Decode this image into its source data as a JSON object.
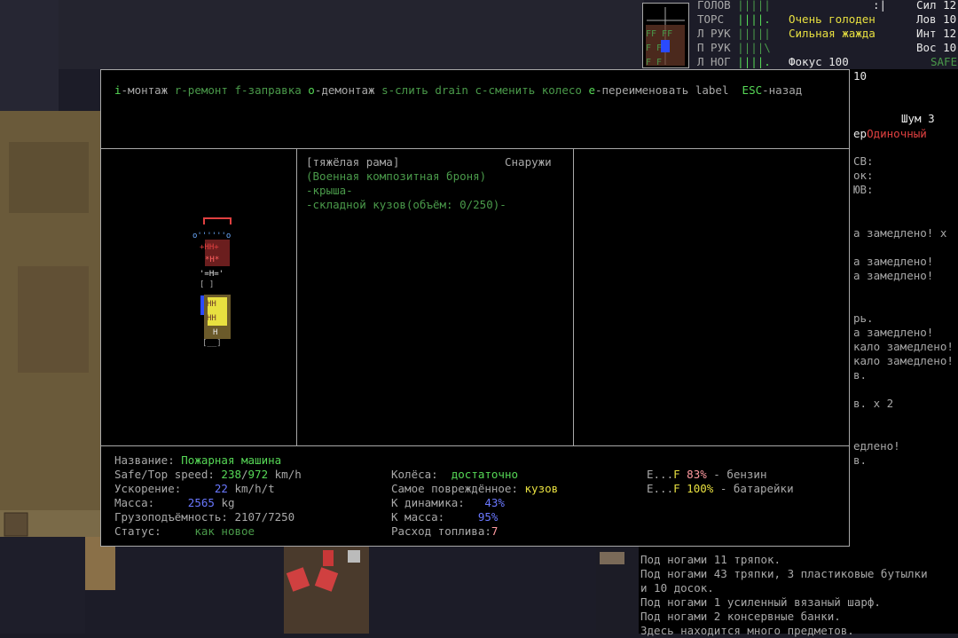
{
  "keys": [
    {
      "k": "i",
      "label": "-монтаж"
    },
    {
      "k": "r",
      "label": "-ремонт"
    },
    {
      "k": "f",
      "label": "-заправка"
    },
    {
      "k": "o",
      "label": "-демонтаж"
    },
    {
      "k": "s",
      "label": "-слить"
    },
    {
      "k": "d",
      "label": "rain"
    },
    {
      "k": "c",
      "label": "-сменить колесо"
    },
    {
      "k": "e",
      "label": "-переименовать label"
    },
    {
      "k": "ESC",
      "label": "-назад"
    }
  ],
  "parts": {
    "frame": "[тяжёлая рама]",
    "location": "Снаружи",
    "armor": "(Военная композитная броня)",
    "roof": "-крыша-",
    "box": "-складной кузов(объём: 0/250)-"
  },
  "stats": {
    "name_label": "Название:",
    "name": "Пожарная машина",
    "speed_label": "Safe/Top speed:",
    "speed_safe": "238",
    "speed_top": "972",
    "speed_unit": "km/h",
    "accel_label": "Ускорение:",
    "accel": "22",
    "accel_unit": "km/h/t",
    "mass_label": "Масса:",
    "mass": "2565",
    "mass_unit": "kg",
    "cargo_label": "Грузоподъёмность:",
    "cargo": "2107/7250",
    "status_label": "Статус:",
    "status": "как новое",
    "wheels_label": "Колёса:",
    "wheels": "достаточно",
    "damaged_label": "Самое повреждённое:",
    "damaged": "кузов",
    "dyn_label": "К динамика:",
    "dyn": "43%",
    "kmass_label": "К масса:",
    "kmass": "95%",
    "fuel_label": "Расход топлива:",
    "fuel": "7",
    "gas_e": "E...",
    "gas_f": "F",
    "gas_pct": "83%",
    "gas_name": "- бензин",
    "bat_e": "E...",
    "bat_f": "F",
    "bat_pct": "100%",
    "bat_name": "- батарейки"
  },
  "hud": {
    "head": "ГОЛОВ",
    "head_bar": "|||||",
    "torso": "ТОРС",
    "torso_bar": "||||.",
    "larm": "Л РУК",
    "larm_bar": "|||||",
    "rarm": "П РУК",
    "rarm_bar": "||||\\",
    "lleg": "Л НОГ",
    "lleg_bar": "||||.",
    "col": ":|",
    "hunger": "Очень голоден",
    "thirst": "Сильная жажда",
    "focus": "Фокус 100",
    "str": "Сил 12",
    "dex": "Лов 10",
    "int": "Инт 12",
    "per": "Вос 10",
    "safe": "SAFE",
    "ten": "10",
    "noise": "Шум 3",
    "mode_pre": "ер",
    "mode": "Одиночный",
    "sv": "СВ:",
    "ok": "ок:",
    "yuv": "ЮВ:",
    "eff": [
      "а замедлено! x",
      "а замедлено!",
      "а замедлено!",
      "рь.",
      "а замедлено!",
      "кало замедлено!",
      "кало замедлено!",
      "в.",
      "в. x 2",
      "едлено!",
      "в."
    ]
  },
  "log": [
    "Под ногами 11 тряпок.",
    "Под ногами 43 тряпки, 3 пластиковые бутылки",
    "и 10 досок.",
    "Под ногами 1 усиленный вязаный шарф.",
    "Под ногами 2 консервные банки.",
    "Здесь находится много предметов."
  ]
}
